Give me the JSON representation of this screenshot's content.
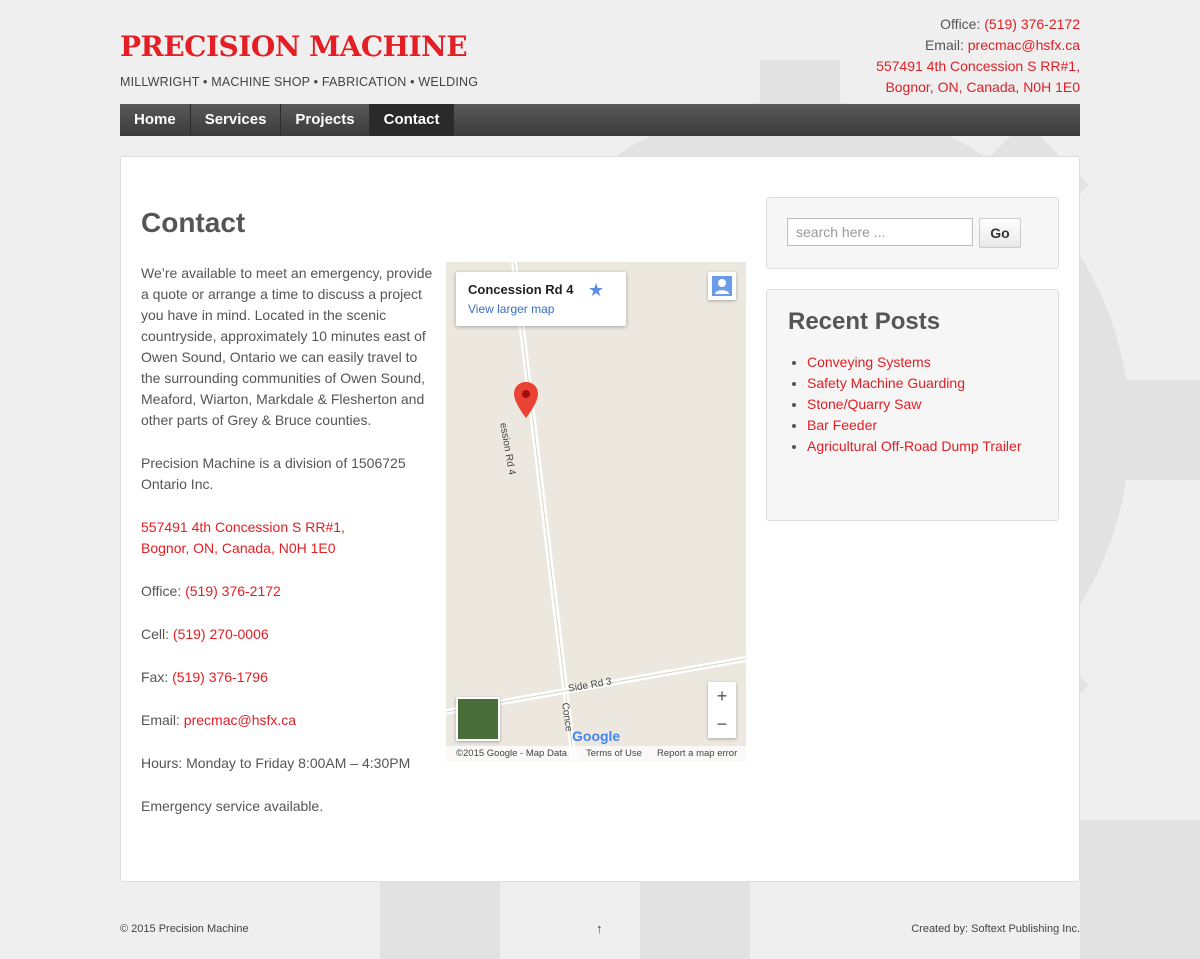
{
  "header": {
    "logo": "PRECISION MACHINE",
    "tagline": "MILLWRIGHT • MACHINE SHOP • FABRICATION • WELDING",
    "office_label": "Office:",
    "office_phone": "(519) 376-2172",
    "email_label": "Email:",
    "email": "precmac@hsfx.ca",
    "address_line1": "557491 4th Concession S RR#1,",
    "address_line2": "Bognor, ON, Canada, N0H 1E0"
  },
  "nav": {
    "items": [
      {
        "label": "Home"
      },
      {
        "label": "Services"
      },
      {
        "label": "Projects"
      },
      {
        "label": "Contact"
      }
    ]
  },
  "content": {
    "title": "Contact",
    "intro": "We’re available to meet an emergency, provide a quote or arrange a time to discuss a project you have in mind. Located in the scenic countryside, approximately 10 minutes east of Owen Sound, Ontario we can easily travel to the surrounding communities of Owen Sound, Meaford, Wiarton, Markdale & Flesherton and other parts of Grey & Bruce counties.",
    "division": "Precision Machine is a division of 1506725 Ontario Inc.",
    "address_line1": "557491 4th Concession S RR#1,",
    "address_line2": "Bognor, ON, Canada, N0H 1E0",
    "office_label": "Office:",
    "office_phone": "(519) 376-2172",
    "cell_label": "Cell:",
    "cell_phone": "(519) 270-0006",
    "fax_label": "Fax:",
    "fax_phone": "(519) 376-1796",
    "email_label": "Email:",
    "email": "precmac@hsfx.ca",
    "hours": "Hours: Monday to Friday 8:00AM – 4:30PM",
    "emergency": "Emergency service available."
  },
  "map": {
    "place_name": "Concession Rd 4",
    "larger_map_link": "View larger map",
    "road_label_1": "ession Rd 4",
    "road_label_2": "Side Rd 3",
    "road_label_3": "Conce",
    "google": "Google",
    "footer_data": "©2015 Google - Map Data",
    "footer_terms": "Terms of Use",
    "footer_report": "Report a map error",
    "zoom_in": "+",
    "zoom_out": "−"
  },
  "sidebar": {
    "search_placeholder": "search here ...",
    "go_label": "Go",
    "recent_posts_title": "Recent Posts",
    "posts": [
      {
        "label": "Conveying Systems"
      },
      {
        "label": "Safety Machine Guarding"
      },
      {
        "label": "Stone/Quarry Saw"
      },
      {
        "label": "Bar Feeder"
      },
      {
        "label": "Agricultural Off-Road Dump Trailer"
      }
    ]
  },
  "footer": {
    "copyright": "© 2015 Precision Machine",
    "up_arrow": "↑",
    "credit_label": "Created by:",
    "credit_name": "Softext Publishing Inc."
  },
  "colors": {
    "brand_red": "#e31e24",
    "nav_dark": "#3a3a3a",
    "link_blue": "#3a6fc4"
  }
}
